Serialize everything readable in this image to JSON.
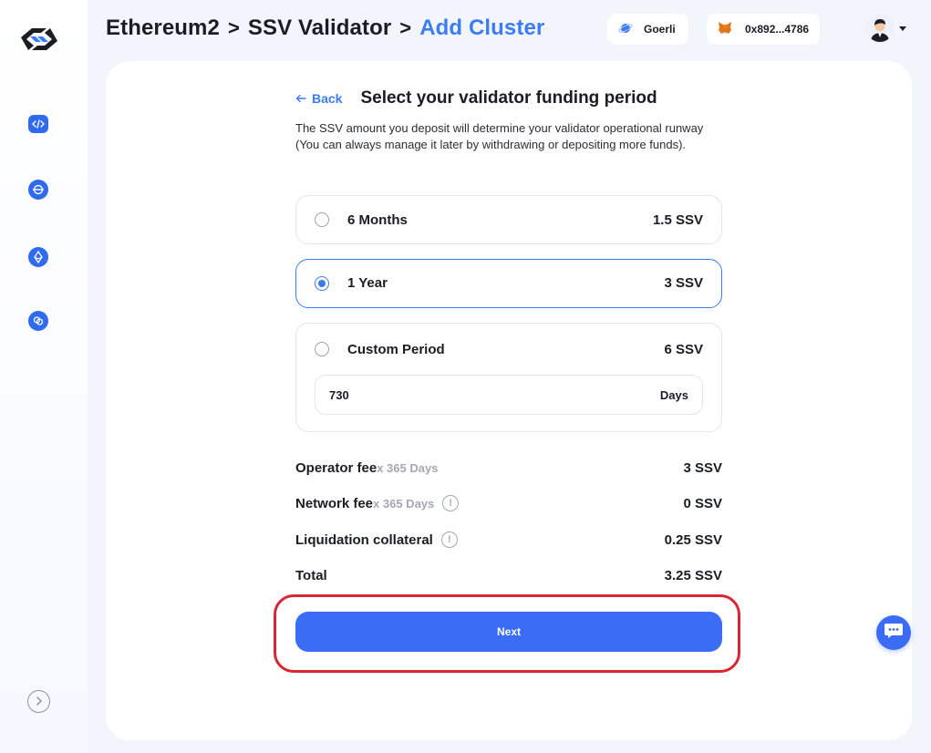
{
  "header": {
    "breadcrumb": [
      "Ethereum2",
      "SSV Validator",
      "Add Cluster"
    ],
    "separator": ">",
    "network": {
      "label": "Goerli",
      "icon": "planet-icon"
    },
    "wallet": {
      "address": "0x892...4786",
      "icon": "metamask-fox-icon"
    },
    "avatar_icon": "user-avatar-icon"
  },
  "sidebar": {
    "items": [
      {
        "name": "code-icon"
      },
      {
        "name": "network-icon"
      },
      {
        "name": "ethereum-icon"
      },
      {
        "name": "link-icon"
      }
    ],
    "expand_icon": "chevron-right-icon"
  },
  "page": {
    "back_label": "Back",
    "title": "Select your validator funding period",
    "description": "The SSV amount you deposit will determine your validator operational runway (You can always manage it later by withdrawing or depositing more funds)."
  },
  "options": [
    {
      "label": "6 Months",
      "value": "1.5 SSV",
      "selected": false
    },
    {
      "label": "1 Year",
      "value": "3 SSV",
      "selected": true
    },
    {
      "label": "Custom Period",
      "value": "6 SSV",
      "selected": false
    }
  ],
  "custom_period": {
    "days_value": "730",
    "unit": "Days"
  },
  "fees": {
    "operator": {
      "label": "Operator fee",
      "sub": "x 365 Days",
      "value": "3 SSV"
    },
    "network": {
      "label": "Network fee",
      "sub": "x 365 Days",
      "value": "0 SSV",
      "info": "!"
    },
    "liquidation": {
      "label": "Liquidation collateral",
      "value": "0.25 SSV",
      "info": "!"
    },
    "total": {
      "label": "Total",
      "value": "3.25 SSV"
    }
  },
  "next_label": "Next",
  "colors": {
    "accent": "#3b7cf5",
    "button": "#3a6cf6",
    "highlight": "#d82632"
  }
}
